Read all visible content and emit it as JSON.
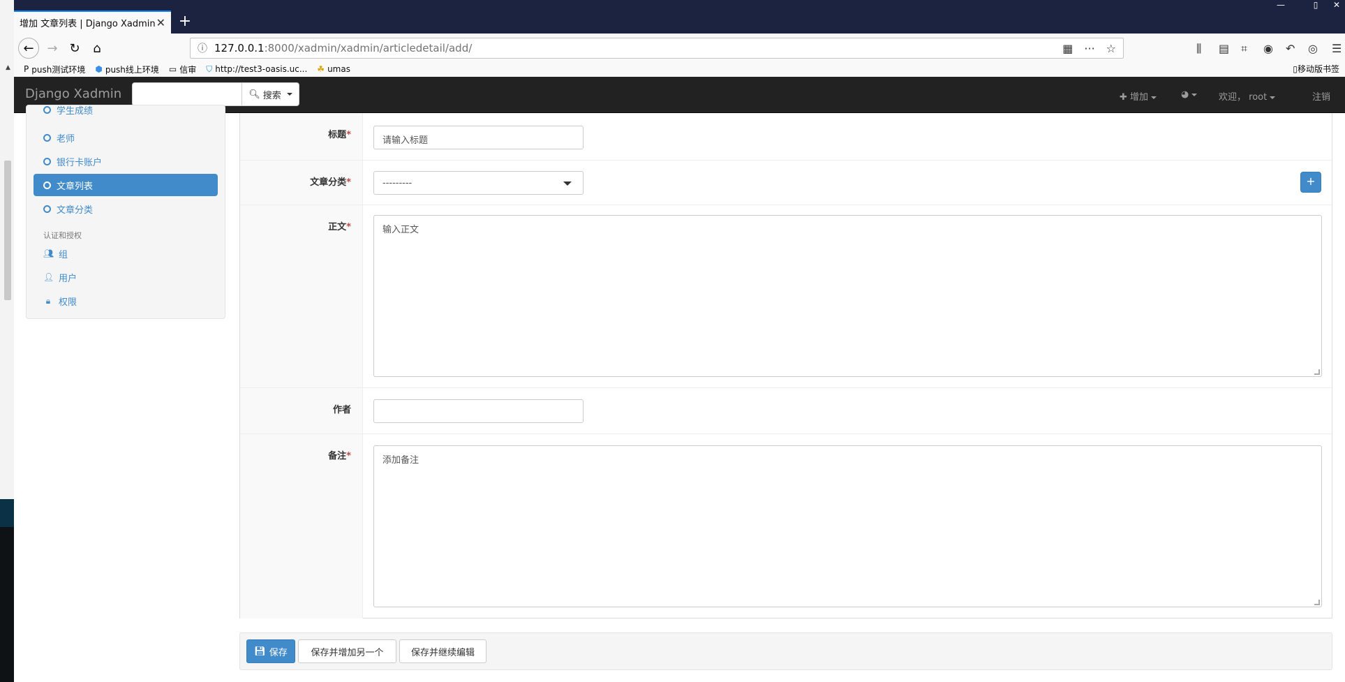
{
  "browser": {
    "tab_title": "增加 文章列表 | Django Xadmin",
    "url_host": "127.0.0.1",
    "url_path": ":8000/xadmin/xadmin/articledetail/add/",
    "bookmarks": [
      {
        "label": "push测试环境",
        "icon": "P"
      },
      {
        "label": "push线上环境",
        "icon": "⬢"
      },
      {
        "label": "信审",
        "icon": "▭"
      },
      {
        "label": "http://test3-oasis.uc...",
        "icon": "⛉"
      },
      {
        "label": "umas",
        "icon": "☘"
      }
    ],
    "mobile_bookmarks": "移动版书签"
  },
  "app": {
    "brand": "Django Xadmin",
    "search_button": "搜索",
    "add_menu": "增加",
    "welcome": "欢迎，",
    "username": "root",
    "logout": "注销"
  },
  "sidebar": {
    "items": [
      {
        "label": "学生成绩",
        "type": "circle"
      },
      {
        "label": "老师",
        "type": "circle"
      },
      {
        "label": "银行卡账户",
        "type": "circle"
      },
      {
        "label": "文章列表",
        "type": "circle",
        "active": true
      },
      {
        "label": "文章分类",
        "type": "circle"
      }
    ],
    "auth_header": "认证和授权",
    "auth_items": [
      {
        "label": "组",
        "icon": "group-icon"
      },
      {
        "label": "用户",
        "icon": "user-icon"
      },
      {
        "label": "权限",
        "icon": "lock-icon"
      }
    ]
  },
  "form": {
    "title_label": "标题",
    "title_placeholder": "请输入标题",
    "category_label": "文章分类",
    "category_value": "---------",
    "body_label": "正文",
    "body_placeholder": "输入正文",
    "author_label": "作者",
    "author_value": "",
    "remark_label": "备注",
    "remark_placeholder": "添加备注",
    "required_mark": "*"
  },
  "actions": {
    "save": "保存",
    "save_add_another": "保存并增加另一个",
    "save_continue": "保存并继续编辑"
  },
  "colors": {
    "primary": "#428bca",
    "navbar": "#222222",
    "titlebar": "#1c2340",
    "required": "#b94a48"
  }
}
